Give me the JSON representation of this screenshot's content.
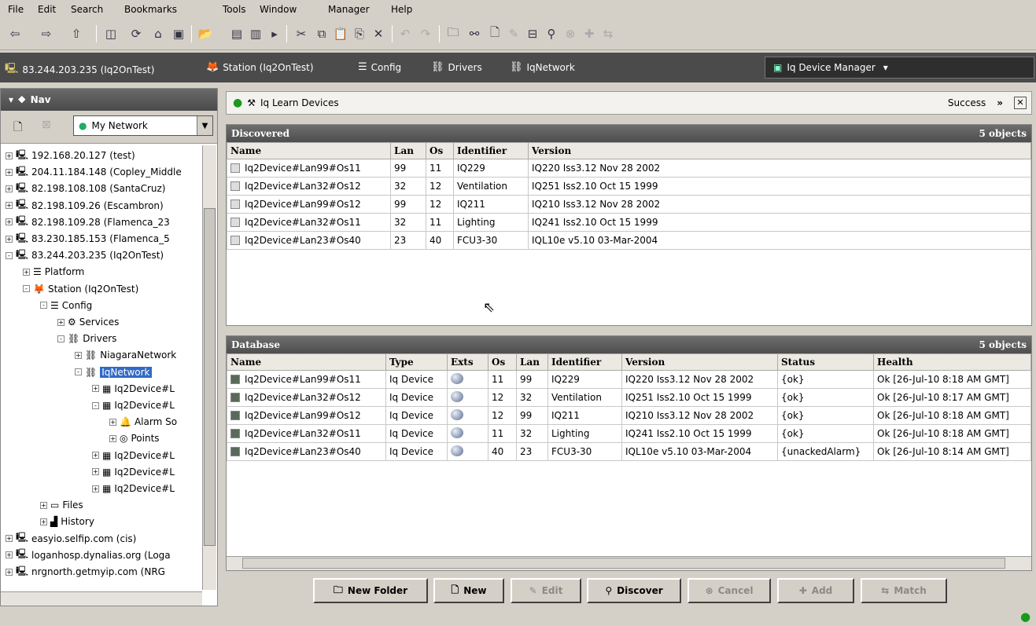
{
  "menu": [
    "File",
    "Edit",
    "Search",
    "Bookmarks",
    "Tools",
    "Window",
    "Manager",
    "Help"
  ],
  "breadcrumbs": [
    {
      "label": "83.244.203.235 (Iq2OnTest)",
      "icon": "computer-icon"
    },
    {
      "label": "Station (Iq2OnTest)",
      "icon": "fox-icon"
    },
    {
      "label": "Config",
      "icon": "config-icon"
    },
    {
      "label": "Drivers",
      "icon": "drivers-icon"
    },
    {
      "label": "IqNetwork",
      "icon": "network-icon"
    }
  ],
  "manager_dropdown": "Iq Device Manager",
  "nav": {
    "title": "Nav",
    "network_select": "My Network",
    "tree": [
      {
        "label": "192.168.20.127 (test)",
        "indent": 0,
        "exp": "+",
        "icon": "computer-icon"
      },
      {
        "label": "204.11.184.148 (Copley_Middle",
        "indent": 0,
        "exp": "+",
        "icon": "computer-icon"
      },
      {
        "label": "82.198.108.108 (SantaCruz)",
        "indent": 0,
        "exp": "+",
        "icon": "computer-icon"
      },
      {
        "label": "82.198.109.26 (Escambron)",
        "indent": 0,
        "exp": "+",
        "icon": "computer-icon"
      },
      {
        "label": "82.198.109.28 (Flamenca_23",
        "indent": 0,
        "exp": "+",
        "icon": "computer-icon"
      },
      {
        "label": "83.230.185.153 (Flamenca_5",
        "indent": 0,
        "exp": "+",
        "icon": "computer-icon"
      },
      {
        "label": "83.244.203.235 (Iq2OnTest)",
        "indent": 0,
        "exp": "-",
        "icon": "computer-icon"
      },
      {
        "label": "Platform",
        "indent": 1,
        "exp": "+",
        "icon": "platform-icon"
      },
      {
        "label": "Station (Iq2OnTest)",
        "indent": 1,
        "exp": "-",
        "icon": "fox-icon"
      },
      {
        "label": "Config",
        "indent": 2,
        "exp": "-",
        "icon": "config-icon"
      },
      {
        "label": "Services",
        "indent": 3,
        "exp": "+",
        "icon": "services-icon"
      },
      {
        "label": "Drivers",
        "indent": 3,
        "exp": "-",
        "icon": "drivers-icon"
      },
      {
        "label": "NiagaraNetwork",
        "indent": 4,
        "exp": "+",
        "icon": "network-icon"
      },
      {
        "label": "IqNetwork",
        "indent": 4,
        "exp": "-",
        "icon": "network-icon",
        "selected": true
      },
      {
        "label": "Iq2Device#L",
        "indent": 5,
        "exp": "+",
        "icon": "device-icon"
      },
      {
        "label": "Iq2Device#L",
        "indent": 5,
        "exp": "-",
        "icon": "device-icon"
      },
      {
        "label": "Alarm So",
        "indent": 6,
        "exp": "+",
        "icon": "alarm-icon"
      },
      {
        "label": "Points",
        "indent": 6,
        "exp": "+",
        "icon": "points-icon"
      },
      {
        "label": "Iq2Device#L",
        "indent": 5,
        "exp": "+",
        "icon": "device-icon"
      },
      {
        "label": "Iq2Device#L",
        "indent": 5,
        "exp": "+",
        "icon": "device-icon"
      },
      {
        "label": "Iq2Device#L",
        "indent": 5,
        "exp": "+",
        "icon": "device-icon"
      },
      {
        "label": "Files",
        "indent": 2,
        "exp": "+",
        "icon": "files-icon"
      },
      {
        "label": "History",
        "indent": 2,
        "exp": "+",
        "icon": "history-icon"
      },
      {
        "label": "easyio.selfip.com (cis)",
        "indent": 0,
        "exp": "+",
        "icon": "computer-icon"
      },
      {
        "label": "loganhosp.dynalias.org (Loga",
        "indent": 0,
        "exp": "+",
        "icon": "computer-icon"
      },
      {
        "label": "nrgnorth.getmyip.com (NRG",
        "indent": 0,
        "exp": "+",
        "icon": "computer-icon"
      }
    ]
  },
  "view": {
    "title": "Iq Learn Devices",
    "status": "Success",
    "arrows": "»"
  },
  "discovered": {
    "title": "Discovered",
    "count": "5 objects",
    "columns": [
      "Name",
      "Lan",
      "Os",
      "Identifier",
      "Version"
    ],
    "rows": [
      [
        "Iq2Device#Lan99#Os11",
        "99",
        "11",
        "IQ229",
        "IQ220 Iss3.12 Nov 28 2002"
      ],
      [
        "Iq2Device#Lan32#Os12",
        "32",
        "12",
        "Ventilation",
        "IQ251 Iss2.10 Oct 15 1999"
      ],
      [
        "Iq2Device#Lan99#Os12",
        "99",
        "12",
        "IQ211",
        "IQ210 Iss3.12 Nov 28 2002"
      ],
      [
        "Iq2Device#Lan32#Os11",
        "32",
        "11",
        "Lighting",
        "IQ241 Iss2.10 Oct 15 1999"
      ],
      [
        "Iq2Device#Lan23#Os40",
        "23",
        "40",
        "FCU3-30",
        "IQL10e v5.10 03-Mar-2004"
      ]
    ]
  },
  "database": {
    "title": "Database",
    "count": "5 objects",
    "columns": [
      "Name",
      "Type",
      "Exts",
      "Os",
      "Lan",
      "Identifier",
      "Version",
      "Status",
      "Health"
    ],
    "rows": [
      [
        "Iq2Device#Lan99#Os11",
        "Iq Device",
        "",
        "11",
        "99",
        "IQ229",
        "IQ220 Iss3.12 Nov 28 2002",
        "{ok}",
        "Ok [26-Jul-10 8:18 AM GMT]"
      ],
      [
        "Iq2Device#Lan32#Os12",
        "Iq Device",
        "",
        "12",
        "32",
        "Ventilation",
        "IQ251 Iss2.10 Oct 15 1999",
        "{ok}",
        "Ok [26-Jul-10 8:17 AM GMT]"
      ],
      [
        "Iq2Device#Lan99#Os12",
        "Iq Device",
        "",
        "12",
        "99",
        "IQ211",
        "IQ210 Iss3.12 Nov 28 2002",
        "{ok}",
        "Ok [26-Jul-10 8:18 AM GMT]"
      ],
      [
        "Iq2Device#Lan32#Os11",
        "Iq Device",
        "",
        "11",
        "32",
        "Lighting",
        "IQ241 Iss2.10 Oct 15 1999",
        "{ok}",
        "Ok [26-Jul-10 8:18 AM GMT]"
      ],
      [
        "Iq2Device#Lan23#Os40",
        "Iq Device",
        "",
        "40",
        "23",
        "FCU3-30",
        "IQL10e v5.10 03-Mar-2004",
        "{unackedAlarm}",
        "Ok [26-Jul-10 8:14 AM GMT]"
      ]
    ]
  },
  "buttons": {
    "new_folder": "New Folder",
    "new": "New",
    "edit": "Edit",
    "discover": "Discover",
    "cancel": "Cancel",
    "add": "Add",
    "match": "Match"
  },
  "colors": {
    "selection": "#316ac5",
    "header_dark": "#4e4e4e",
    "ok_green": "#1a9a1a"
  }
}
